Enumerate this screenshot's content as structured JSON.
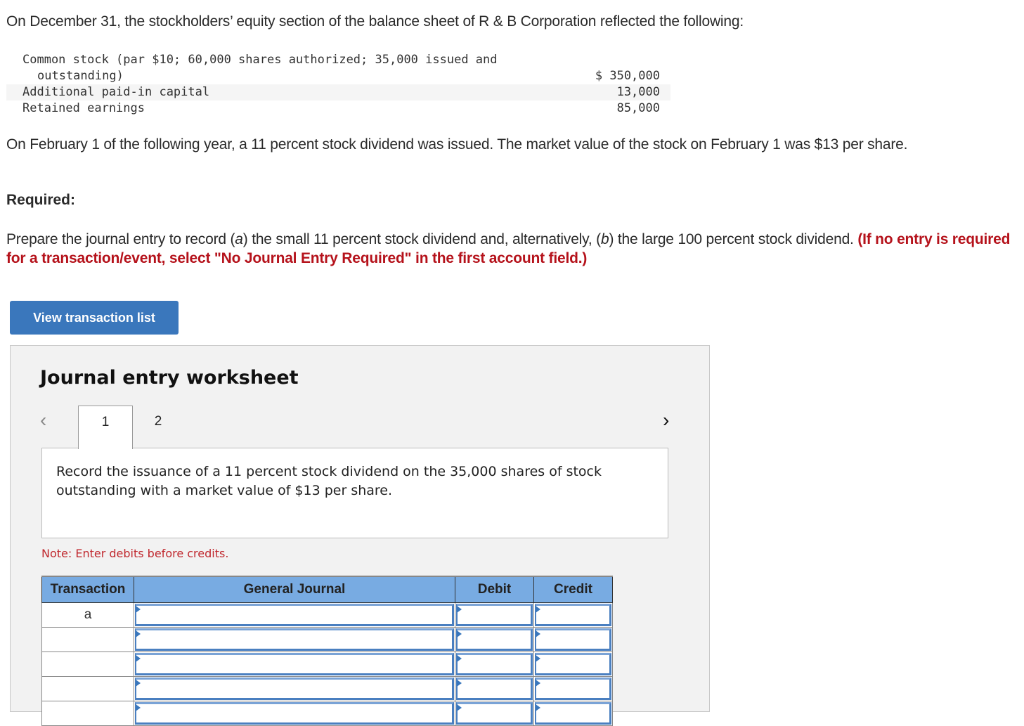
{
  "intro": "On December 31, the stockholders’ equity section of the balance sheet of R & B Corporation reflected the following:",
  "equity": [
    {
      "label": "Common stock (par $10; 60,000 shares authorized; 35,000 issued and",
      "label_cont": "outstanding)",
      "value": "$ 350,000"
    },
    {
      "label": "Additional paid-in capital",
      "value": "13,000"
    },
    {
      "label": "Retained earnings",
      "value": "85,000"
    }
  ],
  "paragraph1": "On February 1 of the following year, a 11 percent stock dividend was issued. The market value of the stock on February 1 was $13 per share.",
  "required_label": "Required:",
  "paragraph2": {
    "part1": "Prepare the journal entry to record (",
    "a": "a",
    "part2": ") the small 11 percent stock dividend and, alternatively, (",
    "b": "b",
    "part3": ") the large 100 percent stock dividend. ",
    "instruction": "(If no entry is required for a transaction/event, select \"No Journal Entry Required\" in the first account field.)"
  },
  "view_button": "View transaction list",
  "worksheet": {
    "title": "Journal entry worksheet",
    "prev_icon": "‹",
    "next_icon": "›",
    "tabs": [
      "1",
      "2"
    ],
    "active_tab": "1",
    "prompt": "Record the issuance of a 11 percent stock dividend on the 35,000 shares of stock outstanding with a market value of $13 per share.",
    "note": "Note: Enter debits before credits.",
    "table": {
      "headers": [
        "Transaction",
        "General Journal",
        "Debit",
        "Credit"
      ],
      "rows": [
        {
          "transaction": "a",
          "account": "",
          "debit": "",
          "credit": ""
        },
        {
          "transaction": "",
          "account": "",
          "debit": "",
          "credit": ""
        },
        {
          "transaction": "",
          "account": "",
          "debit": "",
          "credit": ""
        },
        {
          "transaction": "",
          "account": "",
          "debit": "",
          "credit": ""
        },
        {
          "transaction": "",
          "account": "",
          "debit": "",
          "credit": ""
        }
      ]
    }
  }
}
